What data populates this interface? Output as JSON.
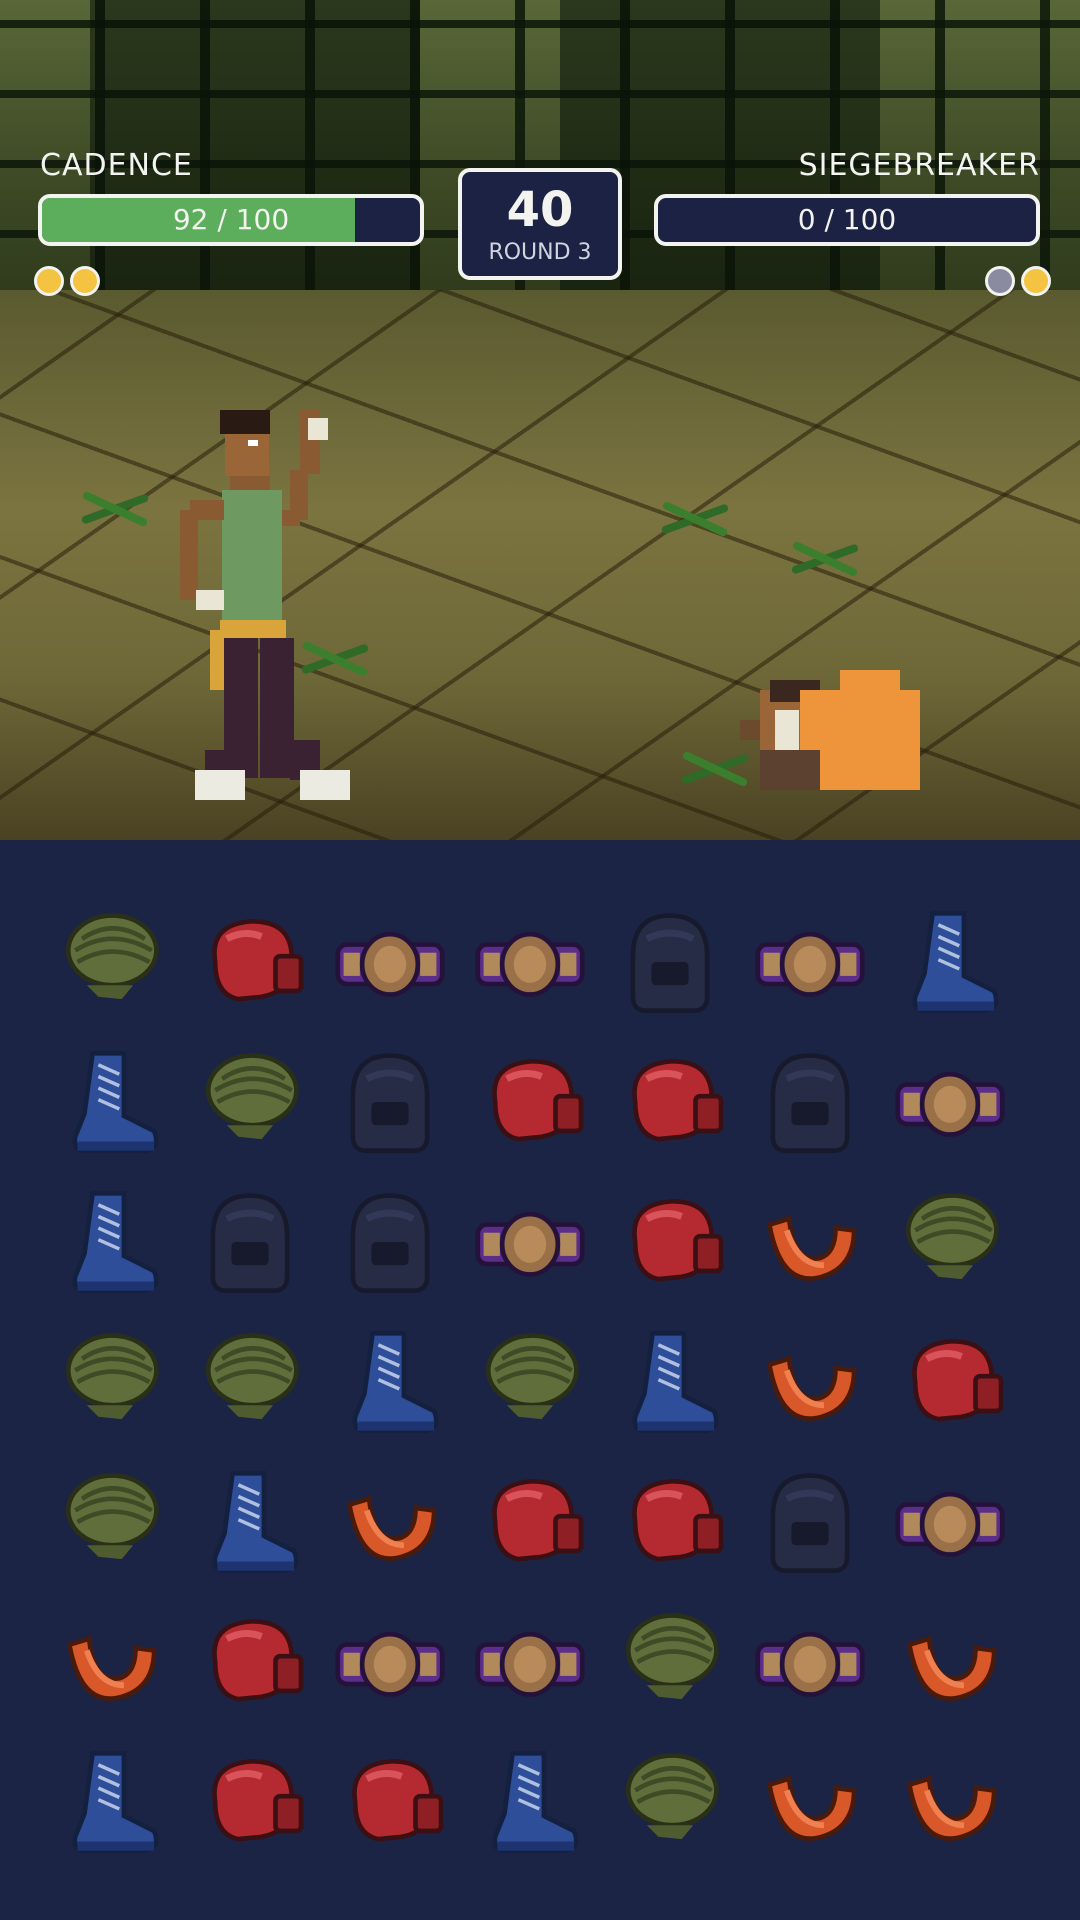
{
  "hud": {
    "player": {
      "name": "CADENCE",
      "hp_text": "92 / 100",
      "hp_fraction": 0.92,
      "rounds": [
        "won",
        "won"
      ]
    },
    "opponent": {
      "name": "SIEGEBREAKER",
      "hp_text": "0 / 100",
      "hp_fraction": 0.0,
      "rounds": [
        "empty",
        "won"
      ]
    },
    "timer": {
      "value": "40",
      "round_label": "ROUND 3"
    }
  },
  "colors": {
    "hp_green": "#5cad5c",
    "round_won": "#f4c342",
    "board_bg": "#1c2445"
  },
  "board": {
    "icons": {
      "wraps": "hand-wraps-icon",
      "glove": "boxing-glove-icon",
      "belt": "championship-belt-icon",
      "helmet": "headgear-icon",
      "boot": "boxing-boot-icon",
      "guard": "mouthguard-icon"
    },
    "grid": [
      [
        "wraps",
        "glove",
        "belt",
        "belt",
        "helmet",
        "belt",
        "boot"
      ],
      [
        "boot",
        "wraps",
        "helmet",
        "glove",
        "glove",
        "helmet",
        "belt"
      ],
      [
        "boot",
        "helmet",
        "helmet",
        "belt",
        "glove",
        "guard",
        "wraps"
      ],
      [
        "wraps",
        "wraps",
        "boot",
        "wraps",
        "boot",
        "guard",
        "glove"
      ],
      [
        "wraps",
        "boot",
        "guard",
        "glove",
        "glove",
        "helmet",
        "belt"
      ],
      [
        "guard",
        "glove",
        "belt",
        "belt",
        "wraps",
        "belt",
        "guard"
      ],
      [
        "boot",
        "glove",
        "glove",
        "boot",
        "wraps",
        "guard",
        "guard"
      ]
    ]
  }
}
